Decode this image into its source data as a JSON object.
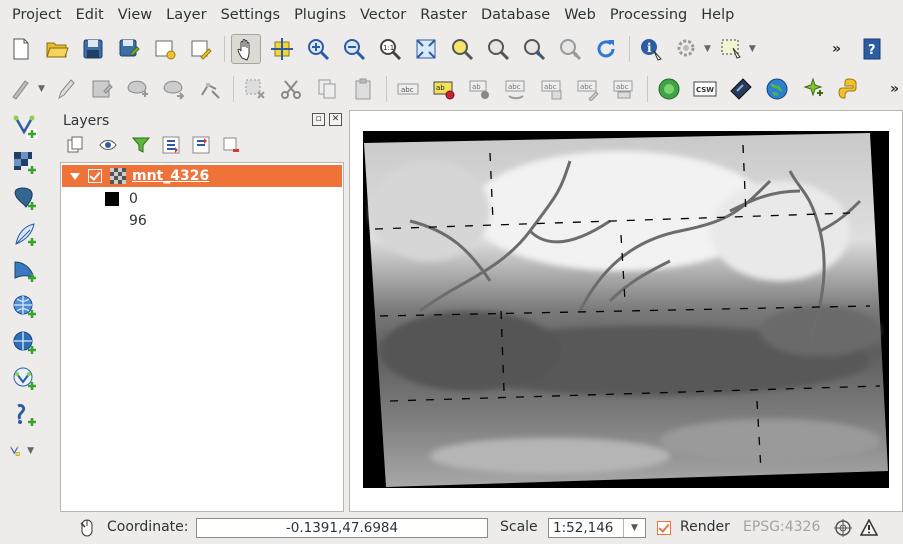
{
  "menu": [
    "Project",
    "Edit",
    "View",
    "Layer",
    "Settings",
    "Plugins",
    "Vector",
    "Raster",
    "Database",
    "Web",
    "Processing",
    "Help"
  ],
  "toolbar_row1": [
    "new-project-icon",
    "open-project-icon",
    "save-project-icon",
    "save-as-icon",
    "new-print-composer-icon",
    "composer-manager-icon",
    "pan-map-icon",
    "pan-to-selection-icon",
    "zoom-in-icon",
    "zoom-out-icon",
    "zoom-native-icon",
    "zoom-full-icon",
    "zoom-to-selection-icon",
    "zoom-to-layer-icon",
    "zoom-last-icon",
    "zoom-next-icon",
    "refresh-icon",
    "identify-icon",
    "action-icon",
    "select-features-icon",
    "help-icon"
  ],
  "toolbar_row2": [
    "current-edits-icon",
    "toggle-editing-icon",
    "save-edits-icon",
    "add-feature-icon",
    "move-feature-icon",
    "node-tool-icon",
    "delete-selected-icon",
    "cut-features-icon",
    "copy-features-icon",
    "paste-features-icon",
    "label-icon",
    "pin-labels-icon",
    "show-hide-labels-icon",
    "move-label-icon",
    "rotate-label-icon",
    "change-label-icon",
    "label-options-icon",
    "geoprocessing-icon",
    "csw-icon",
    "gps-icon",
    "globe-icon",
    "plugin-icon",
    "python-icon"
  ],
  "left_toolbar": [
    "add-vector-layer-icon",
    "add-raster-layer-icon",
    "add-postgis-layer-icon",
    "add-spatialite-layer-icon",
    "add-mssql-layer-icon",
    "add-wms-layer-icon",
    "add-wcs-layer-icon",
    "add-wfs-layer-icon",
    "add-delimited-text-icon",
    "new-shapefile-icon"
  ],
  "layers_panel": {
    "title": "Layers",
    "layer_name": "mnt_4326",
    "legend": {
      "min_label": "0",
      "max_label": "96"
    },
    "swatch_color": "#000000",
    "highlight_color": "#ef7339"
  },
  "overflow_label": "»",
  "statusbar": {
    "coordinate_label": "Coordinate:",
    "coordinate_value": "-0.1391,47.6984",
    "scale_label": "Scale",
    "scale_value": "1:52,146",
    "render_label": "Render",
    "crs": "EPSG:4326"
  }
}
